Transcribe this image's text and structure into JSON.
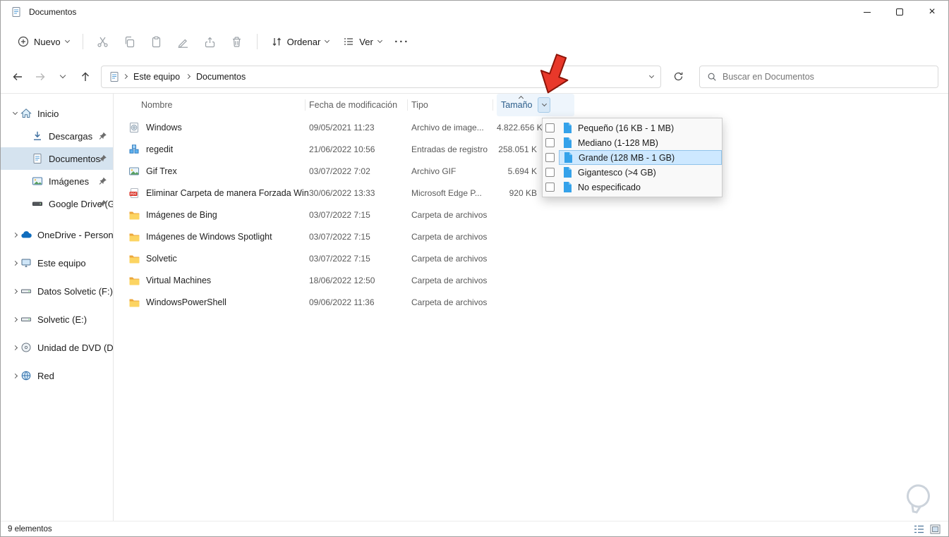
{
  "window": {
    "title": "Documentos"
  },
  "toolbar": {
    "new_label": "Nuevo",
    "sort_label": "Ordenar",
    "view_label": "Ver"
  },
  "address": {
    "breadcrumb": [
      "Este equipo",
      "Documentos"
    ],
    "search_placeholder": "Buscar en Documentos"
  },
  "sidebar": {
    "items": [
      {
        "label": "Inicio",
        "icon": "home-icon"
      },
      {
        "label": "Descargas",
        "icon": "downloads-icon",
        "pinned": true
      },
      {
        "label": "Documentos",
        "icon": "documents-icon",
        "pinned": true,
        "selected": true
      },
      {
        "label": "Imágenes",
        "icon": "pictures-icon",
        "pinned": true
      },
      {
        "label": "Google Drive (G:",
        "icon": "drive-icon",
        "pinned": true
      },
      {
        "label": "OneDrive - Personal",
        "icon": "onedrive-icon"
      },
      {
        "label": "Este equipo",
        "icon": "computer-icon"
      },
      {
        "label": "Datos Solvetic (F:)",
        "icon": "drive-icon"
      },
      {
        "label": "Solvetic (E:)",
        "icon": "drive-icon"
      },
      {
        "label": "Unidad de DVD (D:)",
        "icon": "dvd-icon"
      },
      {
        "label": "Red",
        "icon": "network-icon"
      }
    ]
  },
  "filelist": {
    "columns": {
      "name": "Nombre",
      "date": "Fecha de modificación",
      "type": "Tipo",
      "size": "Tamaño"
    },
    "rows": [
      {
        "name": "Windows",
        "icon": "disc-image-icon",
        "date": "09/05/2021 11:23",
        "type": "Archivo de image...",
        "size": "4.822.656 K"
      },
      {
        "name": "regedit",
        "icon": "registry-icon",
        "date": "21/06/2022 10:56",
        "type": "Entradas de registro",
        "size": "258.051 K"
      },
      {
        "name": "Gif Trex",
        "icon": "gif-image-icon",
        "date": "03/07/2022 7:02",
        "type": "Archivo GIF",
        "size": "5.694 K"
      },
      {
        "name": "Eliminar Carpeta de manera Forzada Win...",
        "icon": "pdf-icon",
        "date": "30/06/2022 13:33",
        "type": "Microsoft Edge P...",
        "size": "920 KB"
      },
      {
        "name": "Imágenes de Bing",
        "icon": "folder-icon",
        "date": "03/07/2022 7:15",
        "type": "Carpeta de archivos",
        "size": ""
      },
      {
        "name": "Imágenes de Windows Spotlight",
        "icon": "folder-icon",
        "date": "03/07/2022 7:15",
        "type": "Carpeta de archivos",
        "size": ""
      },
      {
        "name": "Solvetic",
        "icon": "folder-icon",
        "date": "03/07/2022 7:15",
        "type": "Carpeta de archivos",
        "size": ""
      },
      {
        "name": "Virtual Machines",
        "icon": "folder-icon",
        "date": "18/06/2022 12:50",
        "type": "Carpeta de archivos",
        "size": ""
      },
      {
        "name": "WindowsPowerShell",
        "icon": "folder-icon",
        "date": "09/06/2022 11:36",
        "type": "Carpeta de archivos",
        "size": ""
      }
    ]
  },
  "size_filter_menu": {
    "items": [
      {
        "label": "Pequeño (16 KB - 1 MB)",
        "checked": false,
        "selected": false
      },
      {
        "label": "Mediano (1-128 MB)",
        "checked": false,
        "selected": false
      },
      {
        "label": "Grande (128 MB - 1 GB)",
        "checked": false,
        "selected": true
      },
      {
        "label": "Gigantesco (>4 GB)",
        "checked": false,
        "selected": false
      },
      {
        "label": "No especificado",
        "checked": false,
        "selected": false
      }
    ]
  },
  "statusbar": {
    "items_count": "9 elementos"
  },
  "colors": {
    "accent": "#0067c0",
    "sidebar_selection": "#d5e3ef",
    "menu_highlight": "#cde8ff",
    "annotation_arrow": "#e8382a",
    "folder_yellow": "#fcd462"
  }
}
